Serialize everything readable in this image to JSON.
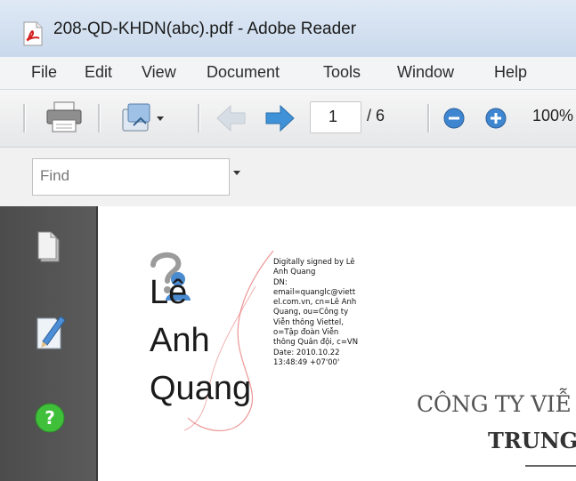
{
  "window": {
    "title": "208-QD-KHDN(abc).pdf - Adobe Reader",
    "icon": "pdf-file-icon"
  },
  "menu": {
    "items": [
      {
        "label": "File"
      },
      {
        "label": "Edit"
      },
      {
        "label": "View"
      },
      {
        "label": "Document"
      },
      {
        "label": "Tools"
      },
      {
        "label": "Window"
      },
      {
        "label": "Help"
      }
    ]
  },
  "toolbar": {
    "icons": [
      "print-icon",
      "share-icon",
      "previous-page-icon",
      "next-page-icon",
      "zoom-out-icon",
      "zoom-in-icon"
    ],
    "page_current": "1",
    "page_total": "/ 6",
    "zoom": "100%"
  },
  "find": {
    "placeholder": "Find"
  },
  "left_panel": {
    "icons": [
      "pages-icon",
      "signatures-icon",
      "help-icon"
    ]
  },
  "document": {
    "signature": {
      "name_lines": [
        "Lê",
        "Anh",
        "Quang"
      ],
      "details": [
        "Digitally signed by Lê",
        "Anh Quang",
        "DN:",
        "email=quanglc@viett",
        "el.com.vn, cn=Lê Anh",
        "Quang, ou=Công ty",
        "Viễn thông Viettel,",
        "o=Tập đoàn Viễn",
        "thông Quân đội, c=VN",
        "Date: 2010.10.22",
        "13:48:49 +07'00'"
      ]
    },
    "company_line": "CÔNG TY VIỄ",
    "trung_line": "TRUNG"
  },
  "colors": {
    "left_panel": "#535353",
    "title_bar": "#d3e0ef",
    "next_arrow": "#3f92d8",
    "help_green": "#3fbf3a"
  }
}
